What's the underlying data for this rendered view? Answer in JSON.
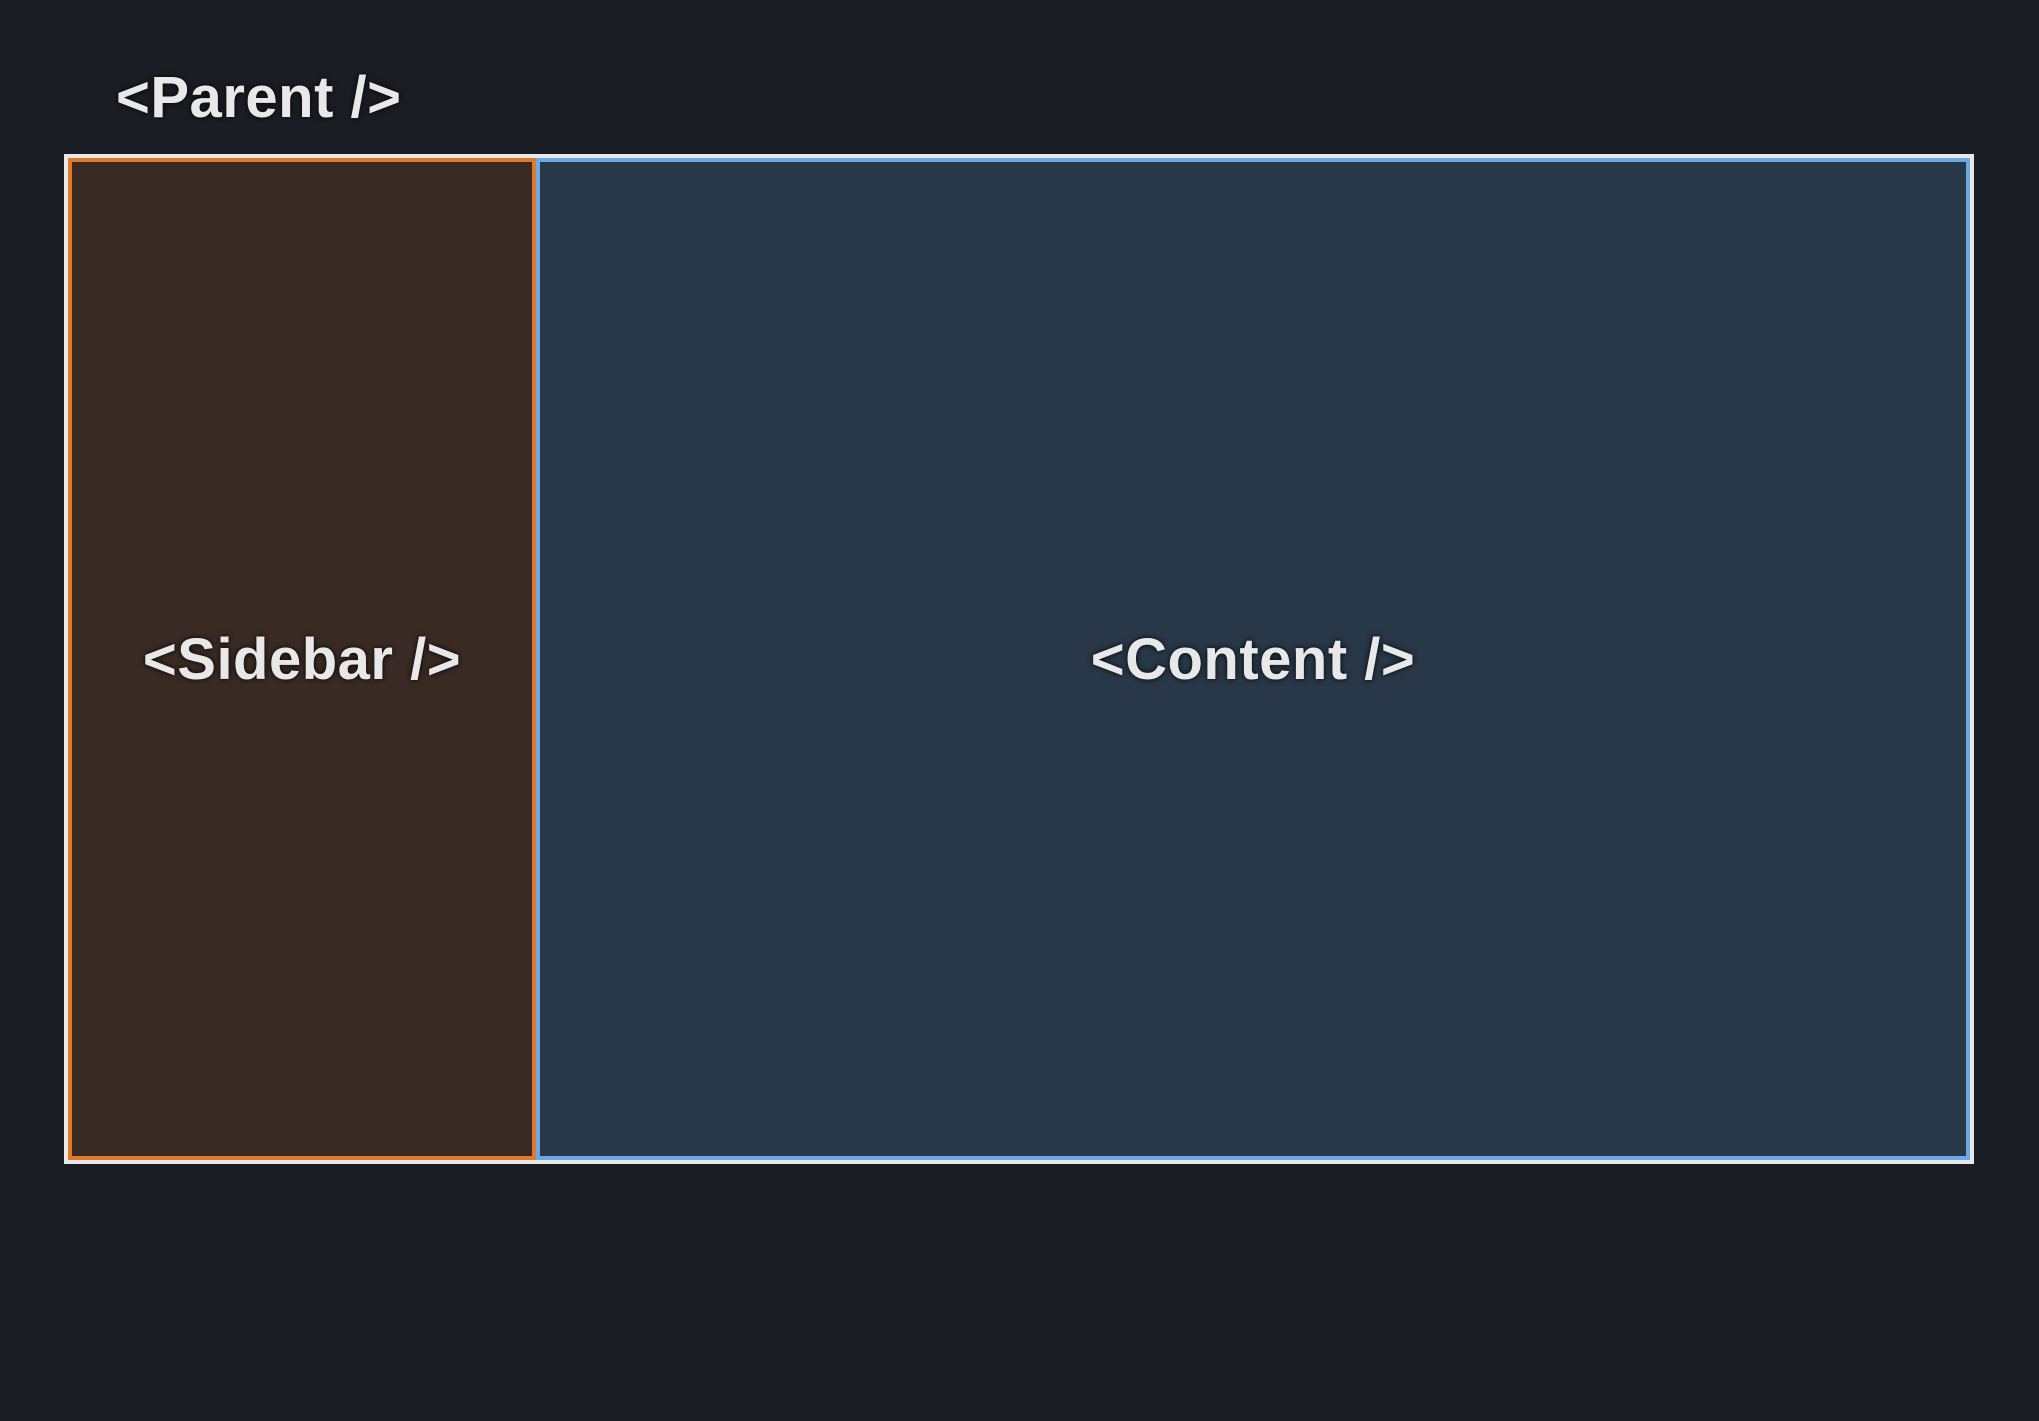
{
  "diagram": {
    "parent_label": "<Parent />",
    "sidebar_label": "<Sidebar />",
    "content_label": "<Content />",
    "colors": {
      "background": "#1a1d24",
      "parent_border": "#e8e8e8",
      "sidebar_fill": "#3a2a24",
      "sidebar_border": "#df7a2a",
      "content_fill": "#283848",
      "content_border": "#6aa9e6",
      "text": "#e8e8e8"
    }
  }
}
